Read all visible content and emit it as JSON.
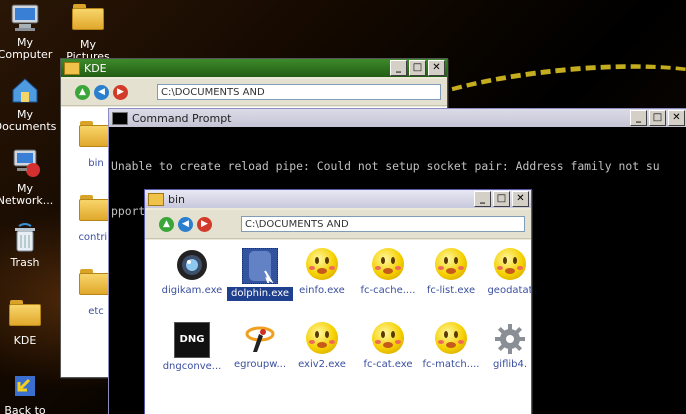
{
  "desktop": {
    "icons": [
      {
        "label": "My\nComputer",
        "icon": "my-computer-icon"
      },
      {
        "label": "My\nPictures",
        "icon": "my-pictures-folder-icon"
      },
      {
        "label": "My\nDocuments",
        "icon": "my-documents-icon"
      },
      {
        "label": "My\nNetwork...",
        "icon": "my-network-icon"
      },
      {
        "label": "Trash",
        "icon": "trash-icon"
      },
      {
        "label": "KDE",
        "icon": "kde-folder-icon"
      },
      {
        "label": "Back to",
        "icon": "back-to-icon"
      }
    ]
  },
  "kde_window": {
    "title": "KDE",
    "address": "C:\\DOCUMENTS AND",
    "items": [
      "bin",
      "contrib",
      "etc"
    ]
  },
  "cmd_window": {
    "title": "Command Prompt",
    "output_line1": "Unable to create reload pipe: Could not setup socket pair: Address family not su",
    "output_line2": "pported by protocol family"
  },
  "bin_window": {
    "title": "bin",
    "address": "C:\\DOCUMENTS AND",
    "files": [
      {
        "label": "digikam.exe",
        "icon": "digikam-lens-icon"
      },
      {
        "label": "dolphin.exe",
        "icon": "dolphin-icon",
        "selected": true
      },
      {
        "label": "einfo.exe",
        "icon": "smiley-icon"
      },
      {
        "label": "fc-cache....",
        "icon": "smiley-icon"
      },
      {
        "label": "fc-list.exe",
        "icon": "smiley-icon"
      },
      {
        "label": "geodatat",
        "icon": "smiley-icon"
      },
      {
        "label": "dngconve...",
        "icon": "dng-icon"
      },
      {
        "label": "egroupw...",
        "icon": "egroupware-icon"
      },
      {
        "label": "exiv2.exe",
        "icon": "smiley-icon"
      },
      {
        "label": "fc-cat.exe",
        "icon": "smiley-icon"
      },
      {
        "label": "fc-match....",
        "icon": "smiley-icon"
      },
      {
        "label": "giflib4.",
        "icon": "gear-icon"
      }
    ]
  },
  "window_buttons": {
    "minimize": "_",
    "maximize": "□",
    "close": "✕"
  },
  "colors": {
    "title_green": "#2c6b1e",
    "title_blue": "#2a3f8f",
    "selection": "#1f3f8f",
    "streak": "#d9c022"
  }
}
